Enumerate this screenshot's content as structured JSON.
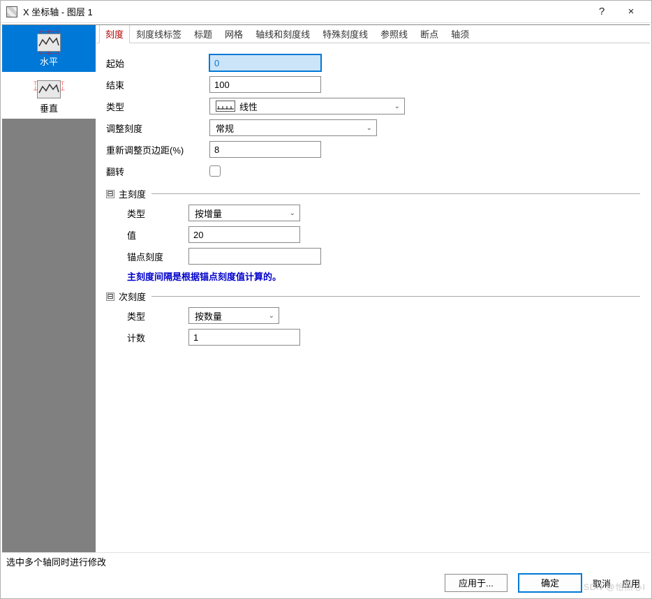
{
  "window": {
    "title": "X 坐标轴 - 图层 1",
    "help": "?",
    "close": "×"
  },
  "sidebar": {
    "items": [
      {
        "label": "水平"
      },
      {
        "label": "垂直"
      }
    ]
  },
  "tabs": [
    {
      "label": "刻度",
      "active": true
    },
    {
      "label": "刻度线标签"
    },
    {
      "label": "标题"
    },
    {
      "label": "网格"
    },
    {
      "label": "轴线和刻度线"
    },
    {
      "label": "特殊刻度线"
    },
    {
      "label": "参照线"
    },
    {
      "label": "断点"
    },
    {
      "label": "轴须"
    }
  ],
  "form": {
    "start_label": "起始",
    "start_value": "0",
    "end_label": "结束",
    "end_value": "100",
    "type_label": "类型",
    "type_value": "线性",
    "adjust_label": "调整刻度",
    "adjust_value": "常规",
    "margin_label": "重新调整页边距(%)",
    "margin_value": "8",
    "flip_label": "翻转"
  },
  "major": {
    "section": "主刻度",
    "type_label": "类型",
    "type_value": "按增量",
    "value_label": "值",
    "value_value": "20",
    "anchor_label": "锚点刻度",
    "anchor_value": "",
    "note": "主刻度间隔是根据锚点刻度值计算的。"
  },
  "minor": {
    "section": "次刻度",
    "type_label": "类型",
    "type_value": "按数量",
    "count_label": "计数",
    "count_value": "1"
  },
  "status": "选中多个轴同时进行修改",
  "footer": {
    "apply_to": "应用于...",
    "ok": "确定",
    "cancel": "取消",
    "apply": "应用"
  },
  "watermark": "SDN @怡然心I",
  "glyphs": {
    "minus": "⊟",
    "chev": "⌄"
  }
}
